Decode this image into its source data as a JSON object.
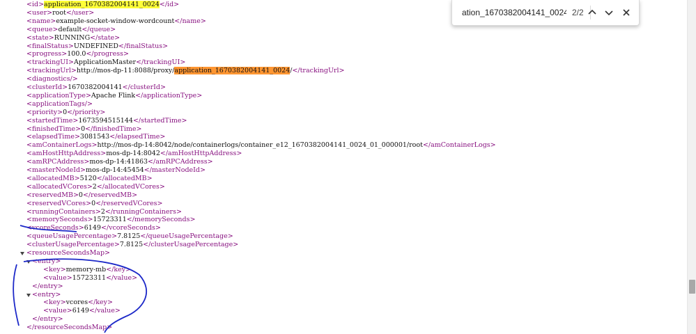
{
  "find_bar": {
    "query": "ation_1670382004141_0024",
    "match_count": "2/2",
    "prev_icon": "chevron-up-icon",
    "next_icon": "chevron-down-icon",
    "close_icon": "close-icon"
  },
  "xml_lines": [
    {
      "open": "<id>",
      "pre": "",
      "hl": "application_1670382004141_0024",
      "hl_type": "yellow",
      "post": "",
      "close": "</id>"
    },
    {
      "open": "<user>",
      "pre": "root",
      "hl": "",
      "post": "",
      "close": "</user>"
    },
    {
      "open": "<name>",
      "pre": "example-socket-window-wordcount",
      "hl": "",
      "post": "",
      "close": "</name>"
    },
    {
      "open": "<queue>",
      "pre": "default",
      "hl": "",
      "post": "",
      "close": "</queue>"
    },
    {
      "open": "<state>",
      "pre": "RUNNING",
      "hl": "",
      "post": "",
      "close": "</state>"
    },
    {
      "open": "<finalStatus>",
      "pre": "UNDEFINED",
      "hl": "",
      "post": "",
      "close": "</finalStatus>"
    },
    {
      "open": "<progress>",
      "pre": "100.0",
      "hl": "",
      "post": "",
      "close": "</progress>"
    },
    {
      "open": "<trackingUI>",
      "pre": "ApplicationMaster",
      "hl": "",
      "post": "",
      "close": "</trackingUI>"
    },
    {
      "open": "<trackingUrl>",
      "pre": "http://mos-dp-11:8088/proxy/",
      "hl": "application_1670382004141_0024",
      "hl_type": "orange",
      "post": "/",
      "close": "</trackingUrl>"
    },
    {
      "open": "<diagnostics/>",
      "pre": "",
      "hl": "",
      "post": "",
      "close": ""
    },
    {
      "open": "<clusterId>",
      "pre": "1670382004141",
      "hl": "",
      "post": "",
      "close": "</clusterId>"
    },
    {
      "open": "<applicationType>",
      "pre": "Apache Flink",
      "hl": "",
      "post": "",
      "close": "</applicationType>"
    },
    {
      "open": "<applicationTags/>",
      "pre": "",
      "hl": "",
      "post": "",
      "close": ""
    },
    {
      "open": "<priority>",
      "pre": "0",
      "hl": "",
      "post": "",
      "close": "</priority>"
    },
    {
      "open": "<startedTime>",
      "pre": "1673594515144",
      "hl": "",
      "post": "",
      "close": "</startedTime>"
    },
    {
      "open": "<finishedTime>",
      "pre": "0",
      "hl": "",
      "post": "",
      "close": "</finishedTime>"
    },
    {
      "open": "<elapsedTime>",
      "pre": "3081543",
      "hl": "",
      "post": "",
      "close": "</elapsedTime>"
    },
    {
      "open": "<amContainerLogs>",
      "pre": "http://mos-dp-14:8042/node/containerlogs/container_e12_1670382004141_0024_01_000001/root",
      "hl": "",
      "post": "",
      "close": "</amContainerLogs>"
    },
    {
      "open": "<amHostHttpAddress>",
      "pre": "mos-dp-14:8042",
      "hl": "",
      "post": "",
      "close": "</amHostHttpAddress>"
    },
    {
      "open": "<amRPCAddress>",
      "pre": "mos-dp-14:41863",
      "hl": "",
      "post": "",
      "close": "</amRPCAddress>"
    },
    {
      "open": "<masterNodeId>",
      "pre": "mos-dp-14:45454",
      "hl": "",
      "post": "",
      "close": "</masterNodeId>"
    },
    {
      "open": "<allocatedMB>",
      "pre": "5120",
      "hl": "",
      "post": "",
      "close": "</allocatedMB>"
    },
    {
      "open": "<allocatedVCores>",
      "pre": "2",
      "hl": "",
      "post": "",
      "close": "</allocatedVCores>"
    },
    {
      "open": "<reservedMB>",
      "pre": "0",
      "hl": "",
      "post": "",
      "close": "</reservedMB>"
    },
    {
      "open": "<reservedVCores>",
      "pre": "0",
      "hl": "",
      "post": "",
      "close": "</reservedVCores>"
    },
    {
      "open": "<runningContainers>",
      "pre": "2",
      "hl": "",
      "post": "",
      "close": "</runningContainers>"
    },
    {
      "open": "<memorySeconds>",
      "pre": "15723311",
      "hl": "",
      "post": "",
      "close": "</memorySeconds>"
    },
    {
      "open": "<vcoreSeconds>",
      "pre": "6149",
      "hl": "",
      "post": "",
      "close": "</vcoreSeconds>"
    },
    {
      "open": "<queueUsagePercentage>",
      "pre": "7.8125",
      "hl": "",
      "post": "",
      "close": "</queueUsagePercentage>"
    },
    {
      "open": "<clusterUsagePercentage>",
      "pre": "7.8125",
      "hl": "",
      "post": "",
      "close": "</clusterUsagePercentage>"
    },
    {
      "open": "<resourceSecondsMap>",
      "pre": "",
      "hl": "",
      "post": "",
      "close": ""
    },
    {
      "open": "<entry>",
      "pre": "",
      "hl": "",
      "post": "",
      "close": ""
    },
    {
      "open": "<key>",
      "pre": "memory-mb",
      "hl": "",
      "post": "",
      "close": "</key>"
    },
    {
      "open": "<value>",
      "pre": "15723311",
      "hl": "",
      "post": "",
      "close": "</value>"
    },
    {
      "open": "",
      "pre": "",
      "hl": "",
      "post": "",
      "close": "</entry>"
    },
    {
      "open": "<entry>",
      "pre": "",
      "hl": "",
      "post": "",
      "close": ""
    },
    {
      "open": "<key>",
      "pre": "vcores",
      "hl": "",
      "post": "",
      "close": "</key>"
    },
    {
      "open": "<value>",
      "pre": "6149",
      "hl": "",
      "post": "",
      "close": "</value>"
    },
    {
      "open": "",
      "pre": "",
      "hl": "",
      "post": "",
      "close": "</entry>"
    },
    {
      "open": "",
      "pre": "",
      "hl": "",
      "post": "",
      "close": "</resourceSecondsMap>"
    }
  ],
  "colors": {
    "tag": "#881280",
    "highlight_match": "#ffff38",
    "highlight_active": "#ff9632",
    "annotation_ink": "#1c28c8"
  }
}
